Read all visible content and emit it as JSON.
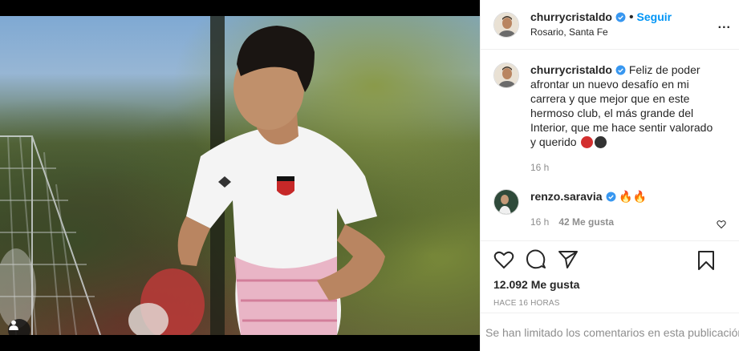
{
  "post": {
    "author": "churrycristaldo",
    "location": "Rosario, Santa Fe",
    "follow_label": "Seguir",
    "dot": "•",
    "more_label": "..."
  },
  "caption": {
    "author": "churrycristaldo",
    "text": "Feliz de poder afrontar un nuevo desafío en mi carrera y que mejor que en este hermoso club, el más grande del Interior, que me hace sentir valorado y querido",
    "time": "16 h"
  },
  "comment": {
    "author": "renzo.saravia",
    "text": "🔥🔥",
    "time": "16 h",
    "likes": "42 Me gusta"
  },
  "engagement": {
    "likes": "12.092 Me gusta",
    "posted": "hace 16 horas",
    "comments_limited": "Se han limitado los comentarios en esta publicación"
  },
  "colors": {
    "accent": "#0095f6",
    "verified": "#3897f0",
    "emoji_red": "#d32f2f",
    "emoji_black": "#333333"
  },
  "icons": [
    "verified-icon",
    "more-icon",
    "heart-icon",
    "comment-icon",
    "share-icon",
    "bookmark-icon",
    "user-tag-icon",
    "fire-emoji"
  ]
}
